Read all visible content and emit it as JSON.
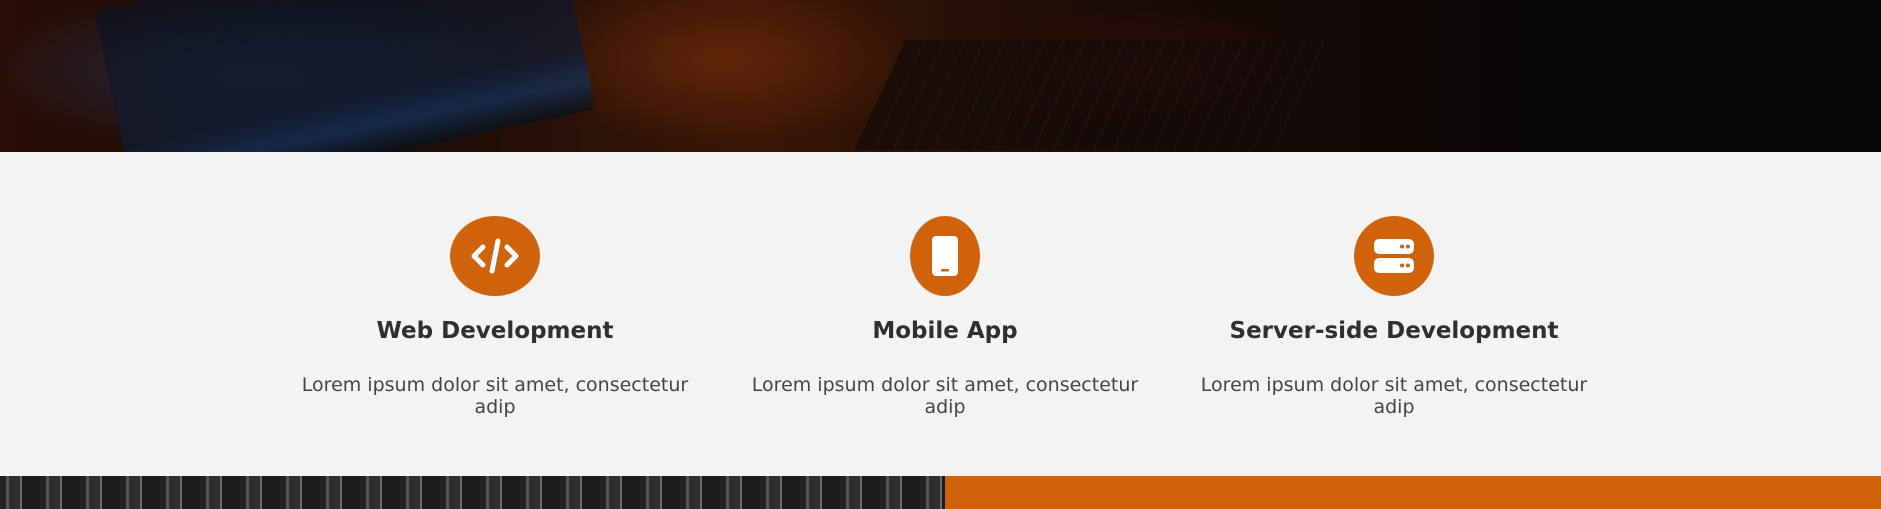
{
  "theme": {
    "accent": "#d0620c",
    "section_bg": "#f3f3f3",
    "title_color": "#2f2f2f",
    "text_color": "#444444"
  },
  "services": [
    {
      "icon": "code-icon",
      "title": "Web Development",
      "description": "Lorem ipsum dolor sit amet, consectetur adip"
    },
    {
      "icon": "mobile-phone-icon",
      "title": "Mobile App",
      "description": "Lorem ipsum dolor sit amet, consectetur adip"
    },
    {
      "icon": "server-icon",
      "title": "Server-side Development",
      "description": "Lorem ipsum dolor sit amet, consectetur adip"
    }
  ]
}
